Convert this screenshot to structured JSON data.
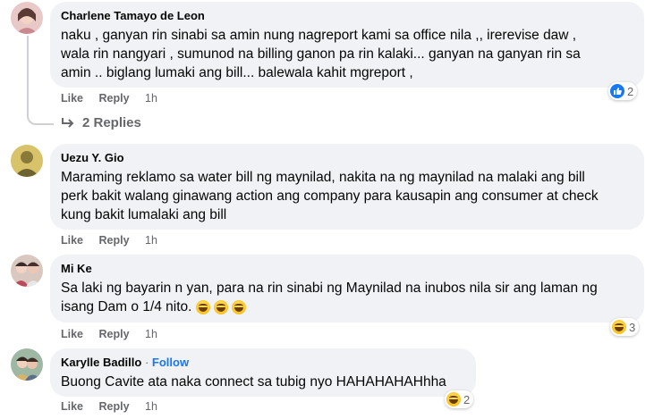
{
  "actions": {
    "like": "Like",
    "reply": "Reply"
  },
  "comments": [
    {
      "author": "Charlene Tamayo de Leon",
      "lines": [
        "naku , ganyan rin sinabi sa amin nung nagreport kami sa office nila ,, irerevise daw ,",
        "wala rin nangyari , sumunod na billing ganon pa rin kalaki... ganyan na ganyan rin sa",
        "amin .. biglang lumaki ang bill... balewala kahit mgreport ,"
      ],
      "time": "1h",
      "reaction": {
        "icon": "like-icon",
        "count": "2"
      },
      "replies_label": "2 Replies"
    },
    {
      "author": "Uezu Y. Gio",
      "lines": [
        "Maraming reklamo sa water bill ng maynilad, nakita na ng maynilad na malaki ang bill",
        "perk bakit walang ginawang action ang company para kausapin ang consumer at check",
        "kung bakit lumalaki ang bill"
      ],
      "time": "1h"
    },
    {
      "author": "Mi Ke",
      "lines": [
        "Sa laki ng bayarin n yan, para na rin sinabi ng Maynilad na inubos nila sir ang laman ng",
        "isang Dam o 1/4 nito."
      ],
      "time": "1h",
      "reaction": {
        "icon": "haha-icon",
        "count": "3"
      }
    },
    {
      "author": "Karylle Badillo",
      "separator": "·",
      "follow": "Follow",
      "lines": [
        "Buong Cavite ata naka connect sa tubig nyo HAHAHAHAHhha"
      ],
      "time": "1h",
      "reaction": {
        "icon": "haha-icon",
        "count": "2"
      }
    }
  ],
  "colors": {
    "bubble": "#f0f2f5",
    "secondary_text": "#65676b",
    "link_blue": "#1877f2",
    "like_blue": "#1877f2",
    "haha_yellow": "#f7b500"
  }
}
